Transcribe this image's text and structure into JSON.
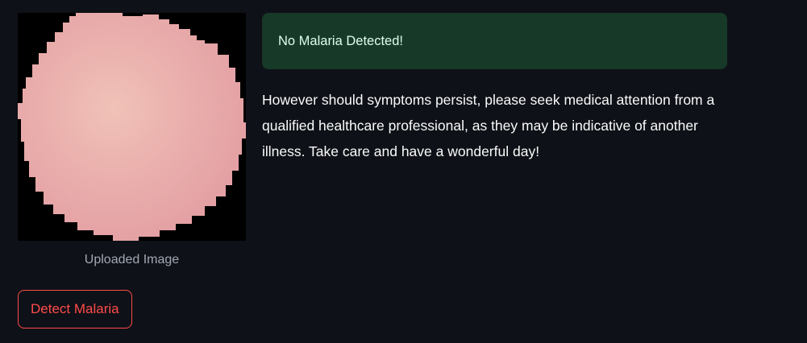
{
  "uploaded_image": {
    "caption": "Uploaded Image"
  },
  "result": {
    "status_message": "No Malaria Detected!",
    "advice": "However should symptoms persist, please seek medical attention from a qualified healthcare professional, as they may be indicative of another illness. Take care and have a wonderful day!"
  },
  "actions": {
    "detect_label": "Detect Malaria"
  },
  "colors": {
    "background": "#0e1117",
    "success_background": "#173928",
    "success_text": "#dffde9",
    "button_accent": "#ff4b4b",
    "cell_pink": "#e8a6a8",
    "cell_highlight": "#f0c2b8"
  }
}
